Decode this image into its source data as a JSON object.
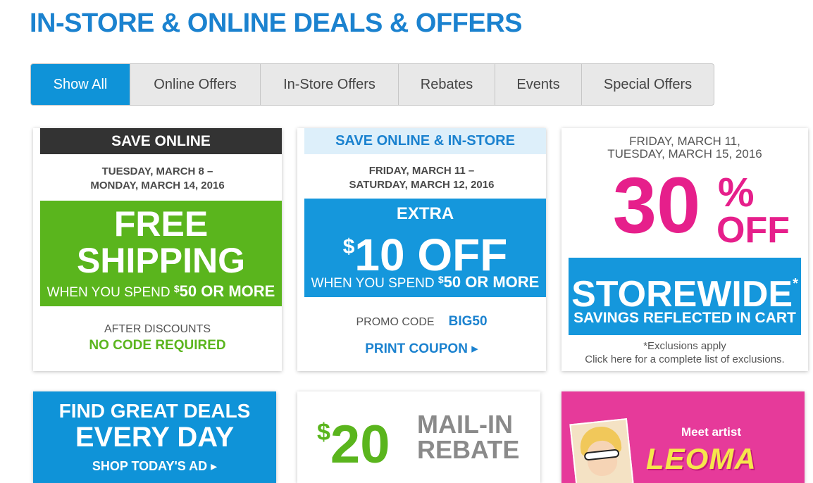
{
  "page": {
    "title": "IN-STORE & ONLINE DEALS & OFFERS"
  },
  "tabs": [
    {
      "label": "Show All",
      "active": true
    },
    {
      "label": "Online Offers",
      "active": false
    },
    {
      "label": "In-Store Offers",
      "active": false
    },
    {
      "label": "Rebates",
      "active": false
    },
    {
      "label": "Events",
      "active": false
    },
    {
      "label": "Special Offers",
      "active": false
    }
  ],
  "colors": {
    "title_blue": "#1b82cf",
    "tab_active": "#0f93d8",
    "green": "#5ab51d",
    "blue": "#1597dc",
    "pink": "#e61f8b",
    "dark_band": "#333333"
  },
  "cards": {
    "free_shipping": {
      "band": "SAVE ONLINE",
      "date_line1": "TUESDAY, MARCH 8 –",
      "date_line2": "MONDAY, MARCH 14, 2016",
      "headline1": "FREE",
      "headline2": "SHIPPING",
      "sub_prefix": "WHEN YOU SPEND ",
      "sub_dollar": "$",
      "sub_amount": "50 OR MORE",
      "after": "AFTER DISCOUNTS",
      "no_code": "NO CODE REQUIRED"
    },
    "extra_ten": {
      "band": "SAVE ONLINE & IN-STORE",
      "date_line1": "FRIDAY, MARCH 11 –",
      "date_line2": "SATURDAY, MARCH 12, 2016",
      "extra": "EXTRA",
      "dollar": "$",
      "amount": "10 OFF",
      "sub_prefix": "WHEN YOU SPEND ",
      "sub_dollar": "$",
      "sub_amount": "50 OR MORE",
      "promo_label": "PROMO CODE",
      "promo_code": "BIG50",
      "print_coupon": "PRINT COUPON ▸"
    },
    "storewide": {
      "date_line1": "FRIDAY, MARCH 11,",
      "date_line2": "TUESDAY, MARCH 15, 2016",
      "percent_num": "30",
      "percent_sign": "%",
      "off": "OFF",
      "storewide": "STOREWIDE",
      "asterisk": "*",
      "savings": "SAVINGS REFLECTED IN CART",
      "exclusions1": "*Exclusions apply",
      "exclusions2": "Click here for a complete list of exclusions."
    },
    "great_deals": {
      "line1": "FIND GREAT DEALS",
      "line2": "EVERY DAY",
      "cta": "SHOP TODAY'S AD ▸"
    },
    "rebate": {
      "dollar": "$",
      "amount": "20",
      "line1": "MAIL-IN",
      "line2": "REBATE"
    },
    "artist": {
      "meet": "Meet artist",
      "name": "LEOMA"
    }
  }
}
